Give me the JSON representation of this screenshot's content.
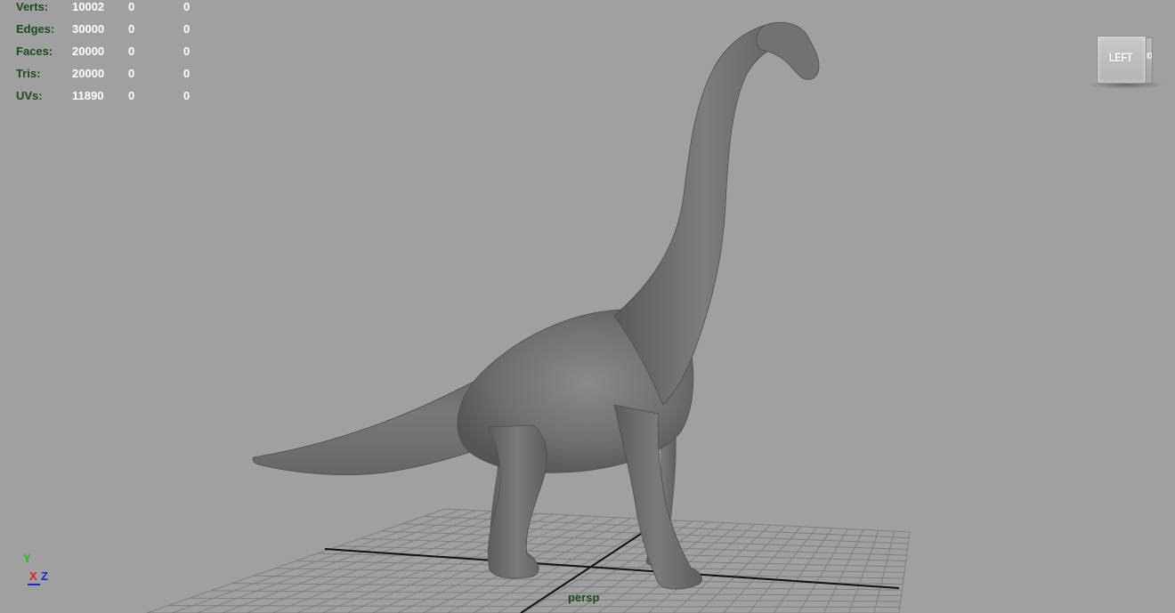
{
  "heads_up_display": {
    "rows": [
      {
        "label": "Verts:",
        "values": [
          "10002",
          "0",
          "0"
        ]
      },
      {
        "label": "Edges:",
        "values": [
          "30000",
          "0",
          "0"
        ]
      },
      {
        "label": "Faces:",
        "values": [
          "20000",
          "0",
          "0"
        ]
      },
      {
        "label": "Tris:",
        "values": [
          "20000",
          "0",
          "0"
        ]
      },
      {
        "label": "UVs:",
        "values": [
          "11890",
          "0",
          "0"
        ]
      }
    ]
  },
  "view_cube": {
    "face_label": "LEFT",
    "side_label": "IO"
  },
  "axis_indicator": {
    "y": "Y",
    "x": "X",
    "z": "Z"
  },
  "camera": {
    "name": "persp"
  },
  "colors": {
    "background": "#a0a0a0",
    "hud_label": "#1d4a1d",
    "hud_value": "#ffffff",
    "model": "#6f6f6f",
    "grid": "#7f7f7f",
    "axis_x": "#e02020",
    "axis_y": "#18c018",
    "axis_z": "#2020e0"
  }
}
